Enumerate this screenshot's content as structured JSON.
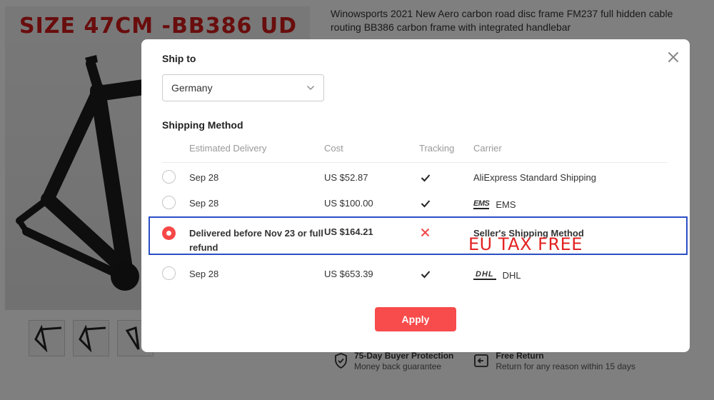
{
  "background": {
    "product_banner": "SIZE 47CM -BB386 UD",
    "product_title": "Winowsports 2021 New Aero carbon road disc frame FM237 full hidden cable routing BB386 carbon frame with integrated handlebar",
    "guarantees": [
      {
        "title": "75-Day Buyer Protection",
        "subtitle": "Money back guarantee",
        "icon": "shield-check-icon"
      },
      {
        "title": "Free Return",
        "subtitle": "Return for any reason within 15 days",
        "icon": "return-box-icon"
      }
    ]
  },
  "modal": {
    "ship_to_label": "Ship to",
    "country": "Germany",
    "shipping_method_label": "Shipping Method",
    "columns": {
      "delivery": "Estimated Delivery",
      "cost": "Cost",
      "tracking": "Tracking",
      "carrier": "Carrier"
    },
    "rows": [
      {
        "delivery": "Sep 28",
        "cost": "US $52.87",
        "tracking": "check-icon",
        "carrier": "AliExpress Standard Shipping",
        "logo": ""
      },
      {
        "delivery": "Sep 28",
        "cost": "US $100.00",
        "tracking": "check-icon",
        "carrier": "EMS",
        "logo": "EMS"
      },
      {
        "delivery": "Delivered before Nov 23 or full refund",
        "cost": "US $164.21",
        "tracking": "cross-icon",
        "carrier": "Seller's Shipping Method",
        "logo": "",
        "selected": true
      },
      {
        "delivery": "Sep 28",
        "cost": "US $653.39",
        "tracking": "check-icon",
        "carrier": "DHL",
        "logo": "DHL"
      }
    ],
    "annotation": "EU TAX FREE",
    "apply_label": "Apply"
  },
  "colors": {
    "accent": "#f84b4b",
    "highlight_border": "#2b4fc4",
    "annotation_text": "#e32222"
  }
}
